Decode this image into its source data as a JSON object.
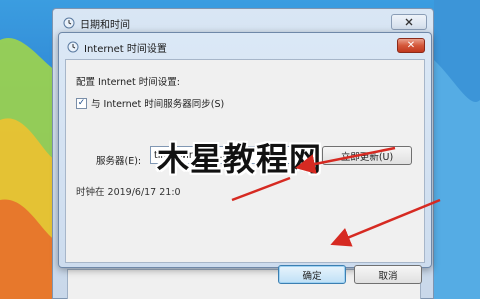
{
  "outer_window": {
    "title": "日期和时间",
    "close_icon": "close-icon"
  },
  "dialog": {
    "title": "Internet 时间设置",
    "close_glyph": "✕",
    "config_label": "配置 Internet 时间设置:",
    "sync_checkbox": {
      "checked": true,
      "glyph": "✓",
      "label": "与 Internet 时间服务器同步(S)"
    },
    "server": {
      "label": "服务器(E):",
      "value": "time.windows.com",
      "dropdown_glyph": "▼"
    },
    "update_button": "立即更新(U)",
    "sync_status": "时钟在 2019/6/17 21:0",
    "ok_button": "确定",
    "cancel_button": "取消"
  },
  "watermark": {
    "text": "木星教程网"
  },
  "colors": {
    "accent_arrow": "#d62a22",
    "close_button": "#c7452b",
    "window_frame": "#cddcee"
  }
}
